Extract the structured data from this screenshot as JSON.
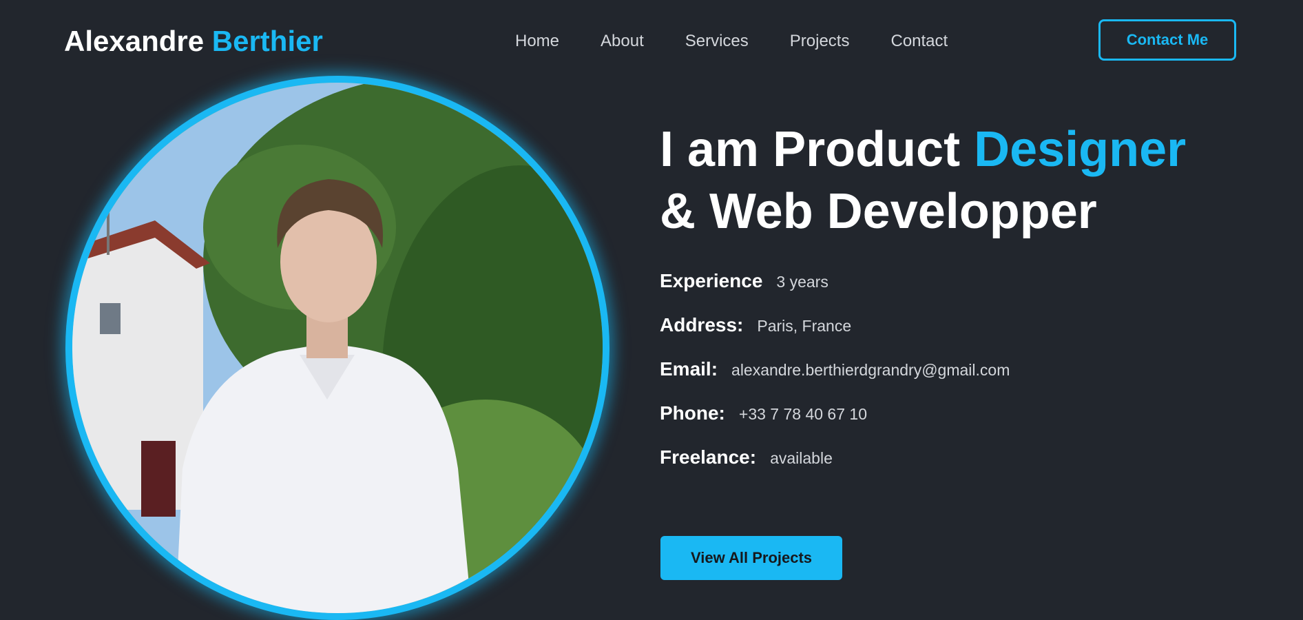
{
  "header": {
    "logo_first": "Alexandre",
    "logo_last": "Berthier",
    "nav": [
      "Home",
      "About",
      "Services",
      "Projects",
      "Contact"
    ],
    "contact_button": "Contact Me"
  },
  "hero": {
    "title_part1": "I am Product",
    "title_accent": "Designer",
    "title_line2": "& Web Developper",
    "info": [
      {
        "label": "Experience",
        "value": "3 years"
      },
      {
        "label": "Address:",
        "value": "Paris, France"
      },
      {
        "label": "Email:",
        "value": "alexandre.berthierdgrandry@gmail.com"
      },
      {
        "label": "Phone:",
        "value": "+33 7 78 40 67 10"
      },
      {
        "label": "Freelance:",
        "value": "available"
      }
    ],
    "projects_button": "View All Projects"
  },
  "colors": {
    "background": "#22262d",
    "accent": "#1ab8f3",
    "text": "#ffffff",
    "muted": "#d4d7dc"
  },
  "portrait": {
    "icon": "portrait-photo"
  }
}
